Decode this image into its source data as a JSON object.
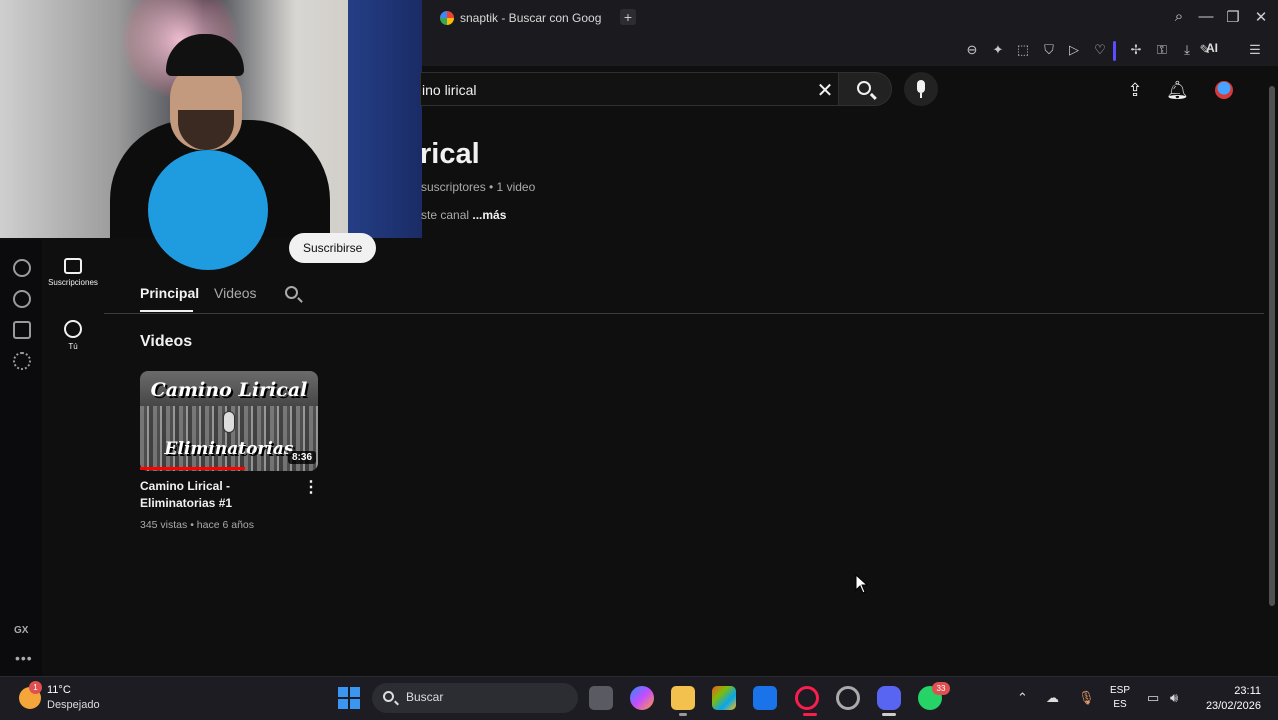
{
  "browser": {
    "tab_title": "snaptik - Buscar con Goog",
    "new_tab": "+",
    "ai_label": "AI"
  },
  "youtube": {
    "search": {
      "value": "ino lirical"
    },
    "guide": [
      {
        "label": "Suscripciones",
        "icon": "subscriptions-icon"
      },
      {
        "label": "Tú",
        "icon": "you-icon"
      }
    ],
    "channel": {
      "name": "rical",
      "meta": "suscriptores • 1 video",
      "desc_prefix": "ste canal",
      "more": "...más",
      "subscribe": "Suscribirse"
    },
    "tabs": [
      {
        "label": "Principal",
        "active": true
      },
      {
        "label": "Videos",
        "active": false
      }
    ],
    "section_title": "Videos",
    "video": {
      "thumb_title_top": "Camino Lirical",
      "thumb_title_bottom": "Eliminatorias",
      "duration": "8:36",
      "watched_fraction": 0.59,
      "title": "Camino Lirical - Eliminatorias #1",
      "meta": "345 vistas • hace 6 años"
    }
  },
  "gx_sidebar": {
    "label": "GX",
    "more": "•••"
  },
  "taskbar": {
    "weather": {
      "badge": "1",
      "temp": "11°C",
      "condition": "Despejado"
    },
    "search_placeholder": "Buscar",
    "whatsapp_badge": "33",
    "lang_top": "ESP",
    "lang_bottom": "ES",
    "time": "23:11",
    "date": "23/02/2026"
  },
  "colors": {
    "accent": "#3ea6ff",
    "progress": "#ff0000",
    "background": "#0f0f0f"
  }
}
